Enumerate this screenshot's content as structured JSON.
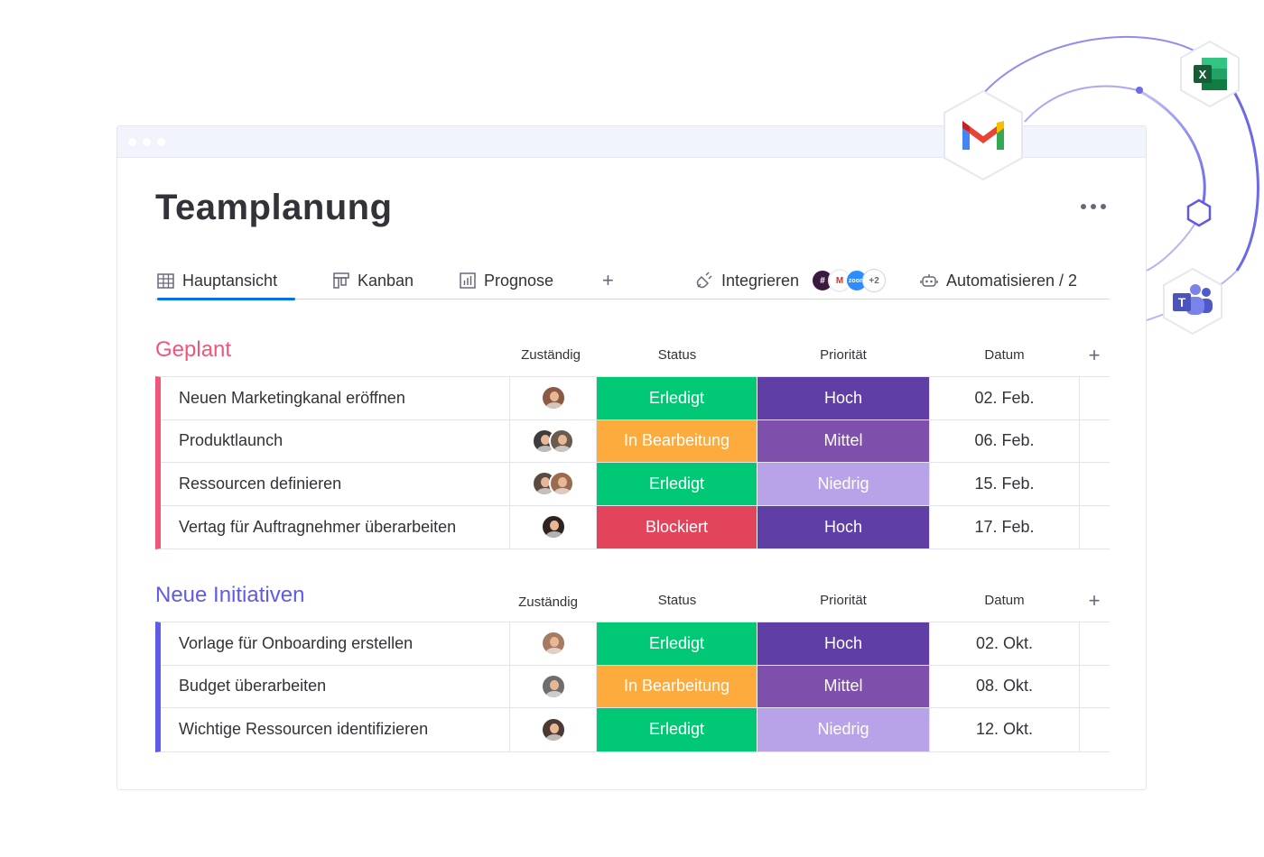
{
  "board": {
    "title": "Teamplanung"
  },
  "tabs": [
    {
      "label": "Hauptansicht",
      "icon": "table-icon"
    },
    {
      "label": "Kanban",
      "icon": "kanban-icon"
    },
    {
      "label": "Prognose",
      "icon": "chart-icon"
    }
  ],
  "toolbar": {
    "add_view": "+",
    "integrate_label": "Integrieren",
    "integrations_more": "+2",
    "automate_label": "Automatisieren / 2"
  },
  "columns": {
    "owner": "Zuständig",
    "status": "Status",
    "priority": "Priorität",
    "date": "Datum",
    "add": "+"
  },
  "colors": {
    "done": "#00c875",
    "working": "#fdab3d",
    "stuck": "#e2445c",
    "high": "#5f3fa6",
    "medium": "#7f4fac",
    "low": "#b9a3e8",
    "group_planned": "#f0567a",
    "group_new": "#5e5ce6"
  },
  "groups": [
    {
      "title": "Geplant",
      "color": "#f0567a",
      "rows": [
        {
          "name": "Neuen Marketingkanal eröffnen",
          "owners": [
            "#8a5a44"
          ],
          "status": "Erledigt",
          "status_color": "#00c875",
          "priority": "Hoch",
          "priority_color": "#5f3fa6",
          "date": "02. Feb."
        },
        {
          "name": "Produktlaunch",
          "owners": [
            "#3d3d3d",
            "#6b5a4e"
          ],
          "status": "In Bearbeitung",
          "status_color": "#fdab3d",
          "priority": "Mittel",
          "priority_color": "#7f4fac",
          "date": "06. Feb."
        },
        {
          "name": "Ressourcen definieren",
          "owners": [
            "#5a4a3f",
            "#9a6b4f"
          ],
          "status": "Erledigt",
          "status_color": "#00c875",
          "priority": "Niedrig",
          "priority_color": "#b9a3e8",
          "date": "15. Feb."
        },
        {
          "name": "Vertag für Auftragnehmer überarbeiten",
          "owners": [
            "#2f2320"
          ],
          "status": "Blockiert",
          "status_color": "#e2445c",
          "priority": "Hoch",
          "priority_color": "#5f3fa6",
          "date": "17. Feb."
        }
      ]
    },
    {
      "title": "Neue Initiativen",
      "color": "#5e5ce6",
      "rows": [
        {
          "name": "Vorlage für Onboarding erstellen",
          "owners": [
            "#a57b62"
          ],
          "status": "Erledigt",
          "status_color": "#00c875",
          "priority": "Hoch",
          "priority_color": "#5f3fa6",
          "date": "02. Okt."
        },
        {
          "name": "Budget überarbeiten",
          "owners": [
            "#6e6e6e"
          ],
          "status": "In Bearbeitung",
          "status_color": "#fdab3d",
          "priority": "Mittel",
          "priority_color": "#7f4fac",
          "date": "08. Okt."
        },
        {
          "name": "Wichtige Ressourcen identifizieren",
          "owners": [
            "#4a3a33"
          ],
          "status": "Erledigt",
          "status_color": "#00c875",
          "priority": "Niedrig",
          "priority_color": "#b9a3e8",
          "date": "12. Okt."
        }
      ]
    }
  ],
  "integrations": [
    {
      "name": "gmail",
      "icon": "gmail-icon"
    },
    {
      "name": "excel",
      "icon": "excel-icon"
    },
    {
      "name": "teams",
      "icon": "teams-icon"
    }
  ]
}
